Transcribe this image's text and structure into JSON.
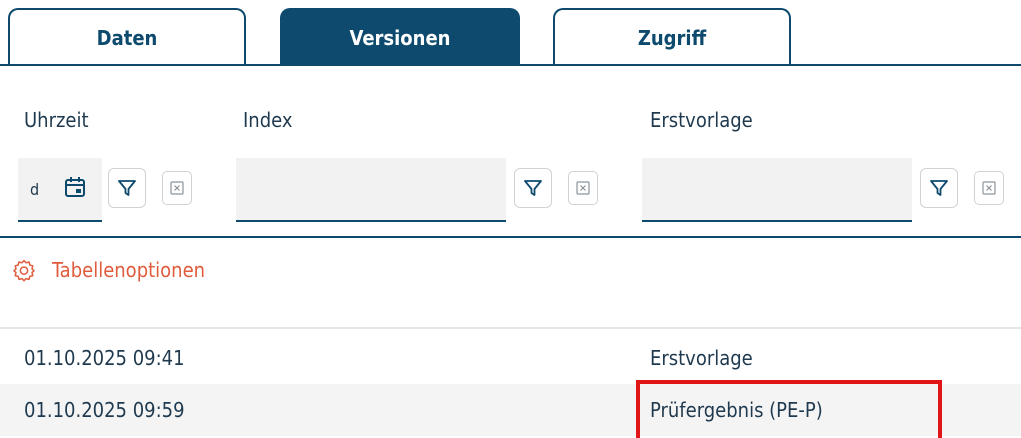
{
  "tabs": [
    {
      "label": "Daten",
      "active": false
    },
    {
      "label": "Versionen",
      "active": true
    },
    {
      "label": "Zugriff",
      "active": false
    }
  ],
  "columns": {
    "time": "Uhrzeit",
    "index": "Index",
    "first_submission": "Erstvorlage"
  },
  "filters": {
    "time_unit": "d",
    "index_value": "",
    "first_submission_value": ""
  },
  "table_options": {
    "label": "Tabellenoptionen"
  },
  "rows": [
    {
      "time": "01.10.2025 09:41",
      "index": "",
      "first_submission": "Erstvorlage"
    },
    {
      "time": "01.10.2025 09:59",
      "index": "",
      "first_submission": "Prüfergebnis (PE-P)"
    }
  ],
  "icons": {
    "calendar": "calendar-icon",
    "filter": "filter-icon",
    "clear": "clear-filter-icon",
    "settings": "gear-icon"
  },
  "colors": {
    "primary": "#0d4a6e",
    "accent": "#e05b3c",
    "highlight": "#e01515"
  }
}
